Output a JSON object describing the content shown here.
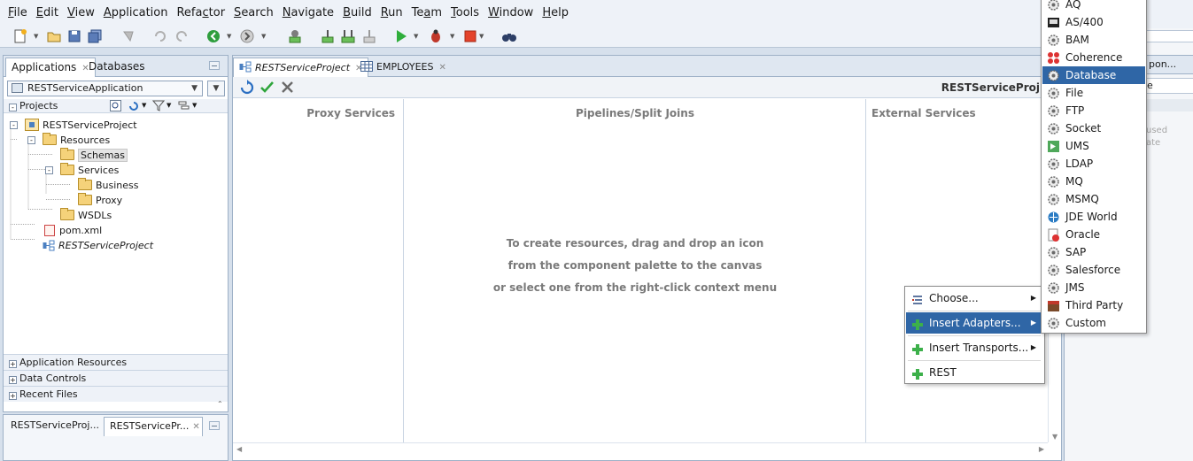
{
  "menubar": {
    "items": [
      "File",
      "Edit",
      "View",
      "Application",
      "Refactor",
      "Search",
      "Navigate",
      "Build",
      "Run",
      "Team",
      "Tools",
      "Window",
      "Help"
    ],
    "mnemonic_index": [
      0,
      0,
      0,
      0,
      4,
      0,
      0,
      0,
      0,
      2,
      0,
      0,
      0
    ]
  },
  "left_panel": {
    "tabs": [
      "Applications",
      "Databases"
    ],
    "application": "RESTServiceApplication",
    "projects_label": "Projects",
    "tree": [
      {
        "label": "RESTServiceProject",
        "kind": "project",
        "level": 0,
        "toggle": "-"
      },
      {
        "label": "Resources",
        "kind": "folder",
        "level": 1,
        "toggle": "-"
      },
      {
        "label": "Schemas",
        "kind": "folder",
        "level": 2,
        "toggle": "",
        "selected": true
      },
      {
        "label": "Services",
        "kind": "folder",
        "level": 2,
        "toggle": "-"
      },
      {
        "label": "Business",
        "kind": "folder",
        "level": 3,
        "toggle": ""
      },
      {
        "label": "Proxy",
        "kind": "folder",
        "level": 3,
        "toggle": ""
      },
      {
        "label": "WSDLs",
        "kind": "folder",
        "level": 2,
        "toggle": ""
      },
      {
        "label": "pom.xml",
        "kind": "pom",
        "level": 1,
        "toggle": ""
      },
      {
        "label": "RESTServiceProject",
        "kind": "sb",
        "level": 1,
        "toggle": "",
        "italic": true
      }
    ],
    "accordions": [
      "Application Resources",
      "Data Controls",
      "Recent Files"
    ]
  },
  "bottom_panel": {
    "tabs": [
      "RESTServiceProj...",
      "RESTServicePr..."
    ]
  },
  "editor": {
    "tabs": [
      "RESTServiceProject",
      "EMPLOYEES"
    ],
    "title": "RESTServiceProj",
    "columns": {
      "proxy": "Proxy Services",
      "pipelines": "Pipelines/Split Joins",
      "external": "External Services"
    },
    "hint_lines": [
      "To create resources, drag and drop an icon",
      "from the component palette to the canvas",
      "or select one from the right-click context menu"
    ]
  },
  "right_panel": {
    "tab_fragment": "pon...",
    "box_fragment": "e",
    "notes": [
      "used",
      "ate"
    ]
  },
  "context_menu": {
    "items": [
      {
        "label": "Choose...",
        "icon": "choose-icon",
        "submenu": true
      },
      {
        "label": "Insert Adapters...",
        "icon": "plus-icon",
        "submenu": true,
        "highlighted": true
      },
      {
        "label": "Insert Transports...",
        "icon": "plus-icon",
        "submenu": true
      },
      {
        "label": "REST",
        "icon": "plus-icon",
        "submenu": false
      }
    ]
  },
  "adapters_submenu": {
    "items": [
      "AQ",
      "AS/400",
      "BAM",
      "Coherence",
      "Database",
      "File",
      "FTP",
      "Socket",
      "UMS",
      "LDAP",
      "MQ",
      "MSMQ",
      "JDE World",
      "Oracle",
      "SAP",
      "Salesforce",
      "JMS",
      "Third Party",
      "Custom"
    ],
    "highlighted": "Database"
  },
  "colors": {
    "highlight": "#2f66a6",
    "chrome": "#eef2f8",
    "border": "#9eb1c7"
  }
}
